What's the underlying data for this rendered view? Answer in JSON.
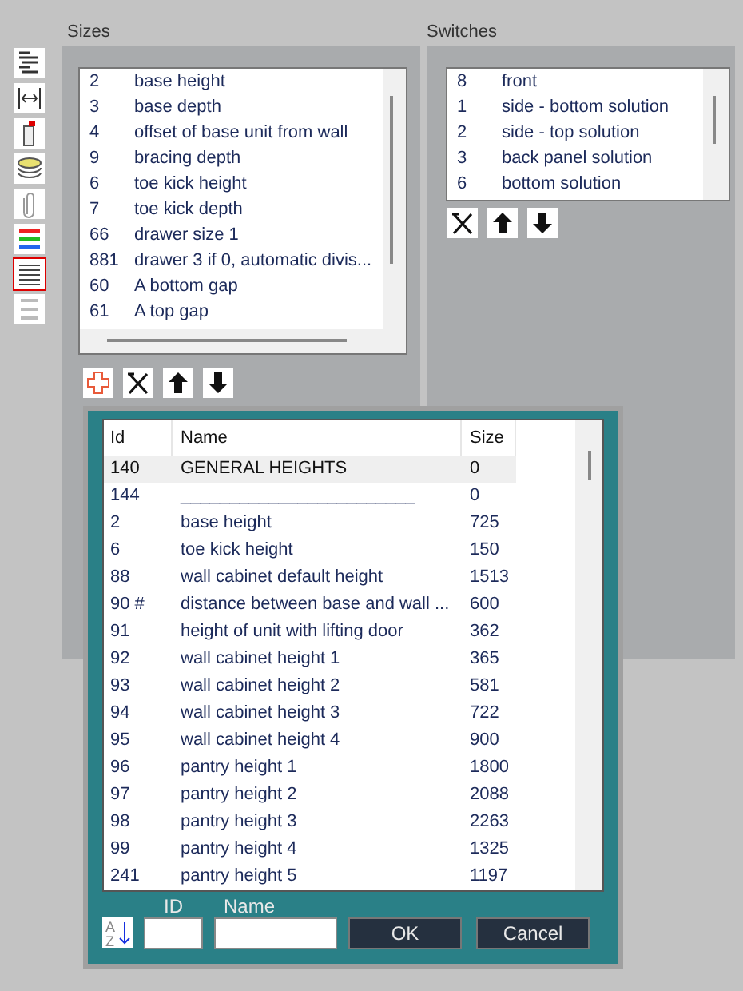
{
  "toolbar": [
    {
      "kind": "outline",
      "selected": false
    },
    {
      "kind": "width",
      "selected": false
    },
    {
      "kind": "panel",
      "selected": false
    },
    {
      "kind": "stack",
      "selected": false
    },
    {
      "kind": "clip",
      "selected": false
    },
    {
      "kind": "colors",
      "selected": false
    },
    {
      "kind": "lines",
      "selected": true
    },
    {
      "kind": "faded",
      "selected": false
    }
  ],
  "sizes": {
    "title": "Sizes",
    "rows": [
      {
        "id": "2",
        "name": "base height"
      },
      {
        "id": "3",
        "name": "base depth"
      },
      {
        "id": "4",
        "name": "offset of base unit from wall"
      },
      {
        "id": "9",
        "name": "bracing depth"
      },
      {
        "id": "6",
        "name": "toe kick height"
      },
      {
        "id": "7",
        "name": "toe kick depth"
      },
      {
        "id": "66",
        "name": "drawer size 1"
      },
      {
        "id": "881",
        "name": "drawer 3 if 0, automatic divis..."
      },
      {
        "id": "60",
        "name": "A bottom gap"
      },
      {
        "id": "61",
        "name": "A top gap"
      }
    ],
    "has_add_button": true
  },
  "switches": {
    "title": "Switches",
    "rows": [
      {
        "id": "8",
        "name": "front"
      },
      {
        "id": "1",
        "name": "side - bottom solution"
      },
      {
        "id": "2",
        "name": "side - top solution"
      },
      {
        "id": "3",
        "name": "back panel solution"
      },
      {
        "id": "6",
        "name": "bottom solution"
      }
    ],
    "has_add_button": false
  },
  "dialog": {
    "columns": [
      "Id",
      "Name",
      "Size"
    ],
    "rows": [
      {
        "id": "140",
        "name": "GENERAL HEIGHTS",
        "size": "0",
        "selected": true
      },
      {
        "id": "144",
        "name": "________________________",
        "size": "0",
        "selected": false
      },
      {
        "id": "2",
        "name": "base height",
        "size": "725",
        "selected": false
      },
      {
        "id": "6",
        "name": "toe kick height",
        "size": "150",
        "selected": false
      },
      {
        "id": "88",
        "name": "wall cabinet default height",
        "size": "1513",
        "selected": false
      },
      {
        "id": "90 #",
        "name": "distance between base and wall ...",
        "size": "600",
        "selected": false
      },
      {
        "id": "91",
        "name": "height of unit with lifting door",
        "size": "362",
        "selected": false
      },
      {
        "id": "92",
        "name": "wall cabinet height 1",
        "size": "365",
        "selected": false
      },
      {
        "id": "93",
        "name": "wall cabinet height 2",
        "size": "581",
        "selected": false
      },
      {
        "id": "94",
        "name": "wall cabinet height 3",
        "size": "722",
        "selected": false
      },
      {
        "id": "95",
        "name": "wall cabinet height 4",
        "size": "900",
        "selected": false
      },
      {
        "id": "96",
        "name": "pantry height 1",
        "size": "1800",
        "selected": false
      },
      {
        "id": "97",
        "name": "pantry height 2",
        "size": "2088",
        "selected": false
      },
      {
        "id": "98",
        "name": "pantry height 3",
        "size": "2263",
        "selected": false
      },
      {
        "id": "99",
        "name": "pantry height 4",
        "size": "1325",
        "selected": false
      },
      {
        "id": "241",
        "name": "pantry height 5",
        "size": "1197",
        "selected": false
      }
    ],
    "sort_letters": [
      "A",
      "Z"
    ],
    "id_label": "ID",
    "name_label": "Name",
    "ok": "OK",
    "cancel": "Cancel"
  }
}
